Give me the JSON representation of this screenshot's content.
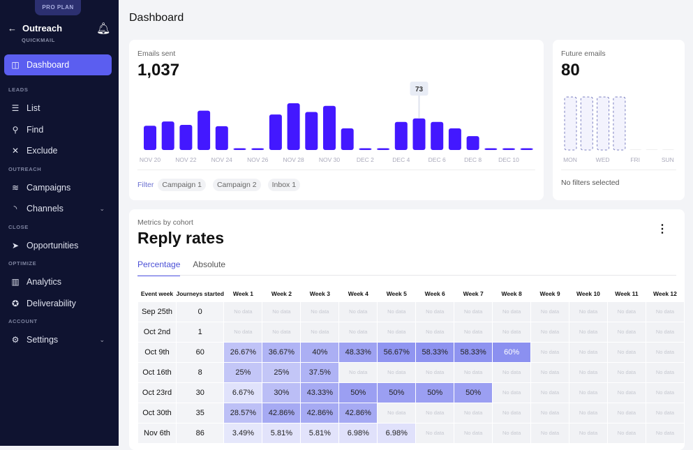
{
  "sidebar": {
    "plan": "PRO PLAN",
    "app": "Outreach",
    "workspace": "QUICKMAIL",
    "items": [
      {
        "label": "Dashboard",
        "icon": "layout-icon",
        "active": true
      },
      {
        "section": "LEADS"
      },
      {
        "label": "List",
        "icon": "list-icon"
      },
      {
        "label": "Find",
        "icon": "search-icon"
      },
      {
        "label": "Exclude",
        "icon": "x-icon"
      },
      {
        "section": "OUTREACH"
      },
      {
        "label": "Campaigns",
        "icon": "layers-icon"
      },
      {
        "label": "Channels",
        "icon": "rss-icon",
        "chevron": true
      },
      {
        "section": "CLOSE"
      },
      {
        "label": "Opportunities",
        "icon": "send-icon"
      },
      {
        "section": "OPTIMIZE"
      },
      {
        "label": "Analytics",
        "icon": "bar-chart-icon"
      },
      {
        "label": "Deliverability",
        "icon": "medal-icon"
      },
      {
        "section": "ACCOUNT"
      },
      {
        "label": "Settings",
        "icon": "gear-icon",
        "chevron": true
      }
    ]
  },
  "page": {
    "title": "Dashboard"
  },
  "emails": {
    "label": "Emails sent",
    "total": "1,037",
    "tooltip": "73",
    "filter_label": "Filter",
    "chips": [
      "Campaign 1",
      "Campaign 2",
      "Inbox 1"
    ]
  },
  "future": {
    "label": "Future emails",
    "total": "80",
    "status": "No filters selected"
  },
  "chart_data": [
    {
      "type": "bar",
      "categories": [
        "Nov 20",
        "Nov 21",
        "Nov 22",
        "Nov 23",
        "Nov 24",
        "Nov 25",
        "Nov 26",
        "Nov 27",
        "Nov 28",
        "Nov 29",
        "Nov 30",
        "Dec 1",
        "Dec 2",
        "Dec 3",
        "Dec 4",
        "Dec 5",
        "Dec 6",
        "Dec 7",
        "Dec 8",
        "Dec 9",
        "Dec 10",
        "Dec 11"
      ],
      "tick_labels": [
        "NOV 20",
        "NOV 22",
        "NOV 24",
        "NOV 26",
        "NOV 28",
        "NOV 30",
        "DEC 2",
        "DEC 4",
        "DEC 6",
        "DEC 8",
        "DEC 10"
      ],
      "values": [
        56,
        66,
        58,
        91,
        55,
        0,
        0,
        82,
        108,
        88,
        102,
        50,
        0,
        0,
        65,
        73,
        65,
        50,
        32,
        0,
        0,
        0
      ],
      "color": "#4318ff",
      "highlight": "Dec 5"
    },
    {
      "type": "bar",
      "categories": [
        "MON",
        "TUE",
        "WED",
        "THU",
        "FRI",
        "SAT",
        "SUN"
      ],
      "tick_labels": [
        "MON",
        "WED",
        "FRI",
        "SUN"
      ],
      "values": [
        20,
        20,
        20,
        20,
        0,
        0,
        0
      ],
      "style": "dashed"
    }
  ],
  "cohort": {
    "subtitle": "Metrics by cohort",
    "title": "Reply rates",
    "tabs": [
      "Percentage",
      "Absolute"
    ],
    "active_tab": "Percentage",
    "headers": [
      "Event week",
      "Journeys started",
      "Week 1",
      "Week 2",
      "Week 3",
      "Week 4",
      "Week 5",
      "Week 6",
      "Week 7",
      "Week 8",
      "Week 9",
      "Week 10",
      "Week 11",
      "Week 12"
    ],
    "no_data": "No data",
    "rows": [
      {
        "week": "Sep 25th",
        "started": "0",
        "values": []
      },
      {
        "week": "Oct 2nd",
        "started": "1",
        "values": []
      },
      {
        "week": "Oct 9th",
        "started": "60",
        "values": [
          "26.67%",
          "36.67%",
          "40%",
          "48.33%",
          "56.67%",
          "58.33%",
          "58.33%",
          "60%"
        ]
      },
      {
        "week": "Oct 16th",
        "started": "8",
        "values": [
          "25%",
          "25%",
          "37.5%"
        ]
      },
      {
        "week": "Oct 23rd",
        "started": "30",
        "values": [
          "6.67%",
          "30%",
          "43.33%",
          "50%",
          "50%",
          "50%",
          "50%"
        ]
      },
      {
        "week": "Oct 30th",
        "started": "35",
        "values": [
          "28.57%",
          "42.86%",
          "42.86%",
          "42.86%"
        ]
      },
      {
        "week": "Nov 6th",
        "started": "86",
        "values": [
          "3.49%",
          "5.81%",
          "5.81%",
          "6.98%",
          "6.98%"
        ]
      }
    ]
  }
}
